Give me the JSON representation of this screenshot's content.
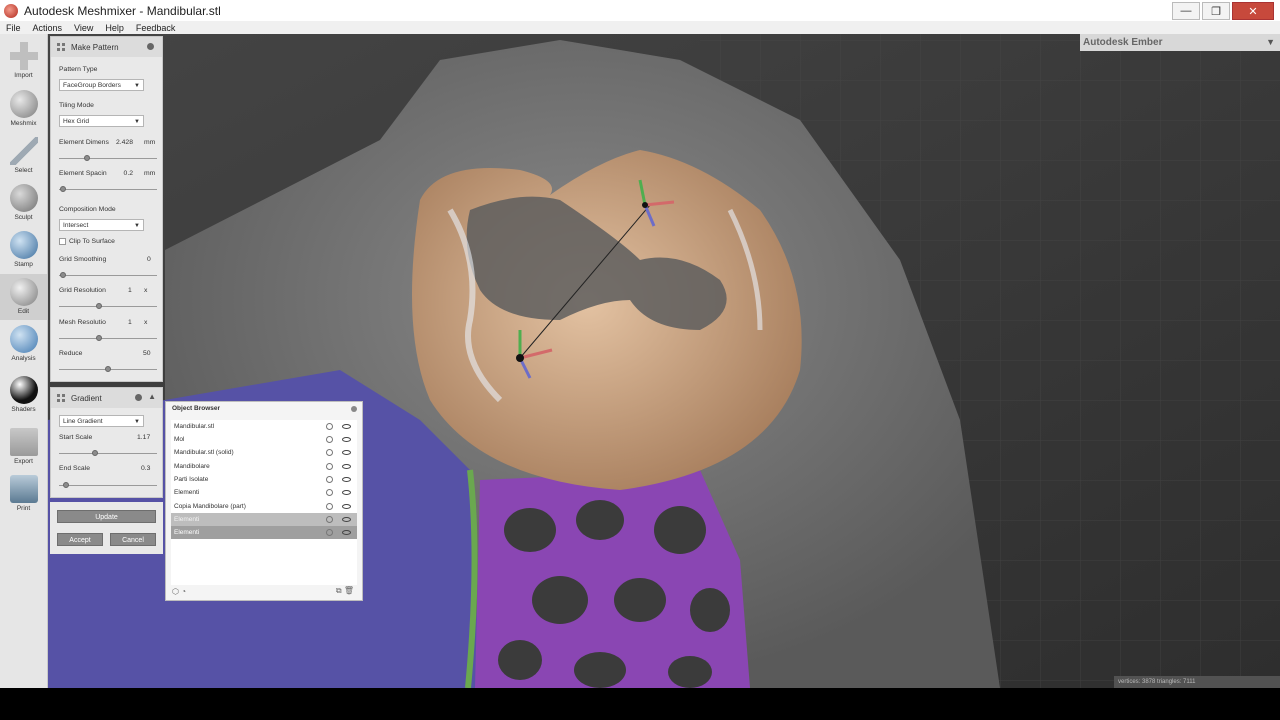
{
  "window": {
    "title": "Autodesk Meshmixer - Mandibular.stl",
    "min": "—",
    "max": "❐",
    "close": "✕"
  },
  "menu": [
    "File",
    "Actions",
    "View",
    "Help",
    "Feedback"
  ],
  "toolbar": [
    {
      "label": "Import",
      "icon": "plus-icon",
      "color": "#bfbfbf"
    },
    {
      "label": "Meshmix",
      "icon": "sphere-icon",
      "color": "#9c9c9c"
    },
    {
      "label": "Select",
      "icon": "arrow-icon",
      "color": "#9ea9b3"
    },
    {
      "label": "Sculpt",
      "icon": "brush-icon",
      "color": "#8a8a8a"
    },
    {
      "label": "Stamp",
      "icon": "stamp-icon",
      "color": "#4a7fb0"
    },
    {
      "label": "Edit",
      "icon": "edit-icon",
      "color": "#8f8f8f"
    },
    {
      "label": "Analysis",
      "icon": "analysis-icon",
      "color": "#5c8fc2"
    },
    {
      "label": "Shaders",
      "icon": "shader-icon",
      "color": "#222222"
    },
    {
      "label": "Export",
      "icon": "export-icon",
      "color": "#a6a6a6"
    },
    {
      "label": "Print",
      "icon": "print-icon",
      "color": "#6f8fa8"
    }
  ],
  "make_pattern": {
    "title": "Make Pattern",
    "pattern_type_label": "Pattern Type",
    "pattern_type": "FaceGroup Borders",
    "tiling_mode_label": "Tiling Mode",
    "tiling_mode": "Hex Grid",
    "element_dim_label": "Element Dimens",
    "element_dim_value": "2.428",
    "element_dim_unit": "mm",
    "element_spacing_label": "Element Spacin",
    "element_spacing_value": "0.2",
    "element_spacing_unit": "mm",
    "composition_label": "Composition Mode",
    "composition": "Intersect",
    "clip_label": "Clip To Surface",
    "grid_smoothing_label": "Grid Smoothing",
    "grid_smoothing_value": "0",
    "grid_resolution_label": "Grid Resolution",
    "grid_resolution_value": "1",
    "grid_resolution_unit": "x",
    "mesh_resolution_label": "Mesh Resolutio",
    "mesh_resolution_value": "1",
    "mesh_resolution_unit": "x",
    "reduce_label": "Reduce",
    "reduce_value": "50"
  },
  "gradient": {
    "title": "Gradient",
    "type": "Line Gradient",
    "start_scale_label": "Start Scale",
    "start_scale_value": "1.17",
    "end_scale_label": "End Scale",
    "end_scale_value": "0.3"
  },
  "buttons": {
    "update": "Update",
    "accept": "Accept",
    "cancel": "Cancel"
  },
  "object_browser": {
    "title": "Object Browser",
    "items": [
      {
        "name": "Mandibular.stl"
      },
      {
        "name": "Mol"
      },
      {
        "name": "Mandibular.stl (solid)"
      },
      {
        "name": "Mandibolare"
      },
      {
        "name": "Parti Isolate"
      },
      {
        "name": "Elementi"
      },
      {
        "name": "Copia Mandibolare (part)"
      },
      {
        "name": "Elementi"
      },
      {
        "name": "Elementi"
      }
    ]
  },
  "ember": {
    "title": "Autodesk Ember"
  },
  "stats": "vertices: 3878 triangles: 7111",
  "colors": {
    "tooth": "#c79f7f",
    "pattern": "#8a46b3",
    "gum": "#5a56a8",
    "mesh": "#6b6b6b"
  }
}
